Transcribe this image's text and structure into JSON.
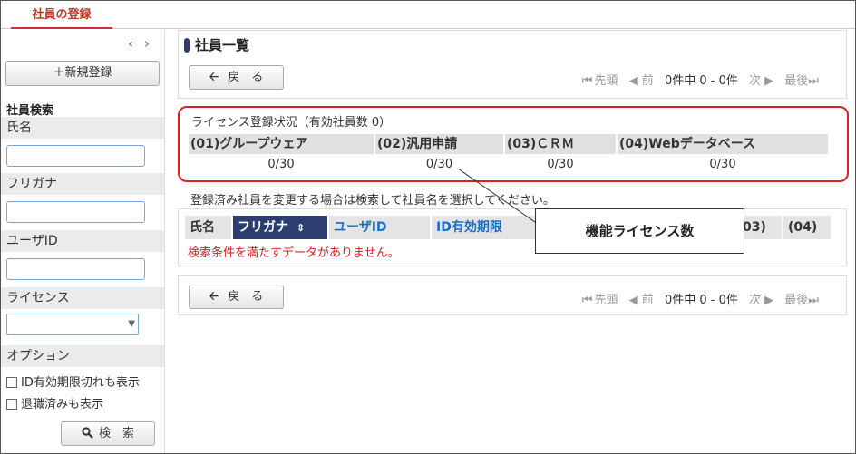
{
  "tab": {
    "label": "社員の登録"
  },
  "sidebar": {
    "nav_prev": "‹",
    "nav_next": "›",
    "new_button": "＋新規登録",
    "search_heading": "社員検索",
    "fields": {
      "name_label": "氏名",
      "kana_label": "フリガナ",
      "userid_label": "ユーザID",
      "license_label": "ライセンス",
      "option_label": "オプション"
    },
    "checks": {
      "expired": "ID有効期限切れも表示",
      "retired": "退職済みも表示"
    },
    "search_button": "検　索",
    "search_icon": "magnifier-icon"
  },
  "main": {
    "title": "社員一覧",
    "back_button": "戻　る",
    "pager": {
      "first": "先頭",
      "prev": "前",
      "status": "0件中 0 - 0件",
      "next": "次",
      "last": "最後"
    },
    "license": {
      "title": "ライセンス登録状況（有効社員数 0）",
      "columns": [
        {
          "label": "(01)グループウェア",
          "value": "0/30"
        },
        {
          "label": "(02)汎用申請",
          "value": "0/30"
        },
        {
          "label": "(03)ＣＲＭ",
          "value": "0/30"
        },
        {
          "label": "(04)Webデータベース",
          "value": "0/30"
        }
      ]
    },
    "note": "登録済み社員を変更する場合は検索して社員名を選択してください。",
    "table": {
      "headers": [
        "氏名",
        "フリガナ",
        "ユーザID",
        "ID有効期限",
        "03)",
        "(04)"
      ],
      "sort_icon": "⇕",
      "empty_message": "検索条件を満たすデータがありません。"
    }
  },
  "callout": {
    "text": "機能ライセンス数"
  },
  "colors": {
    "accent": "#d32f2f",
    "header_active": "#2c3e70",
    "link": "#1a6fc4"
  }
}
